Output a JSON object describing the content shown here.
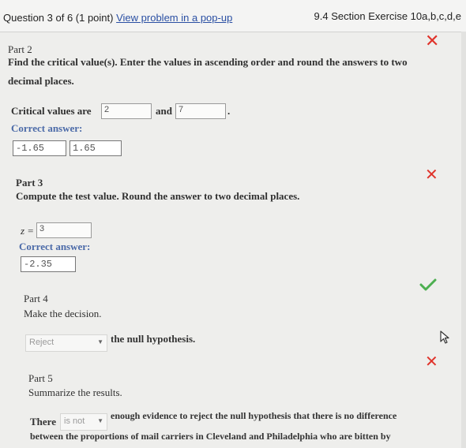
{
  "header": {
    "question": "Question 3 of 6 (1 point)",
    "popup_link": "View problem in a pop-up",
    "section": "9.4 Section Exercise 10a,b,c,d,e"
  },
  "part2": {
    "label": "Part 2",
    "instruction_line1": "Find the critical value(s). Enter the values in ascending order and round the answers to two",
    "instruction_line2": "decimal places.",
    "critical_label": "Critical values are",
    "value1": "2",
    "and": "and",
    "value2": "7",
    "period": ".",
    "correct_label": "Correct answer:",
    "answer1": "-1.65",
    "answer2": "1.65",
    "status": "incorrect"
  },
  "part3": {
    "label": "Part 3",
    "instruction": "Compute the test value. Round the answer to two decimal places.",
    "z_label": "z =",
    "value": "3",
    "correct_label": "Correct answer:",
    "answer": "-2.35",
    "status": "incorrect"
  },
  "part4": {
    "label": "Part 4",
    "instruction": "Make the decision.",
    "select_value": "Reject",
    "suffix": "the null hypothesis.",
    "status": "correct"
  },
  "part5": {
    "label": "Part 5",
    "instruction": "Summarize the results.",
    "prefix": "There",
    "select_value": "is not",
    "line1_rest": "enough evidence to reject the null hypothesis that there is no difference",
    "line2": "between the proportions of mail carriers in Cleveland and Philadelphia who are bitten by",
    "status": "incorrect"
  },
  "colors": {
    "incorrect": "#e0332b",
    "correct": "#4caf50",
    "correct_answer_label": "#4b6aa8",
    "link": "#2a4fa3"
  },
  "icons": [
    "x-mark-icon",
    "check-mark-icon",
    "dropdown-caret-icon",
    "mouse-cursor-icon"
  ]
}
